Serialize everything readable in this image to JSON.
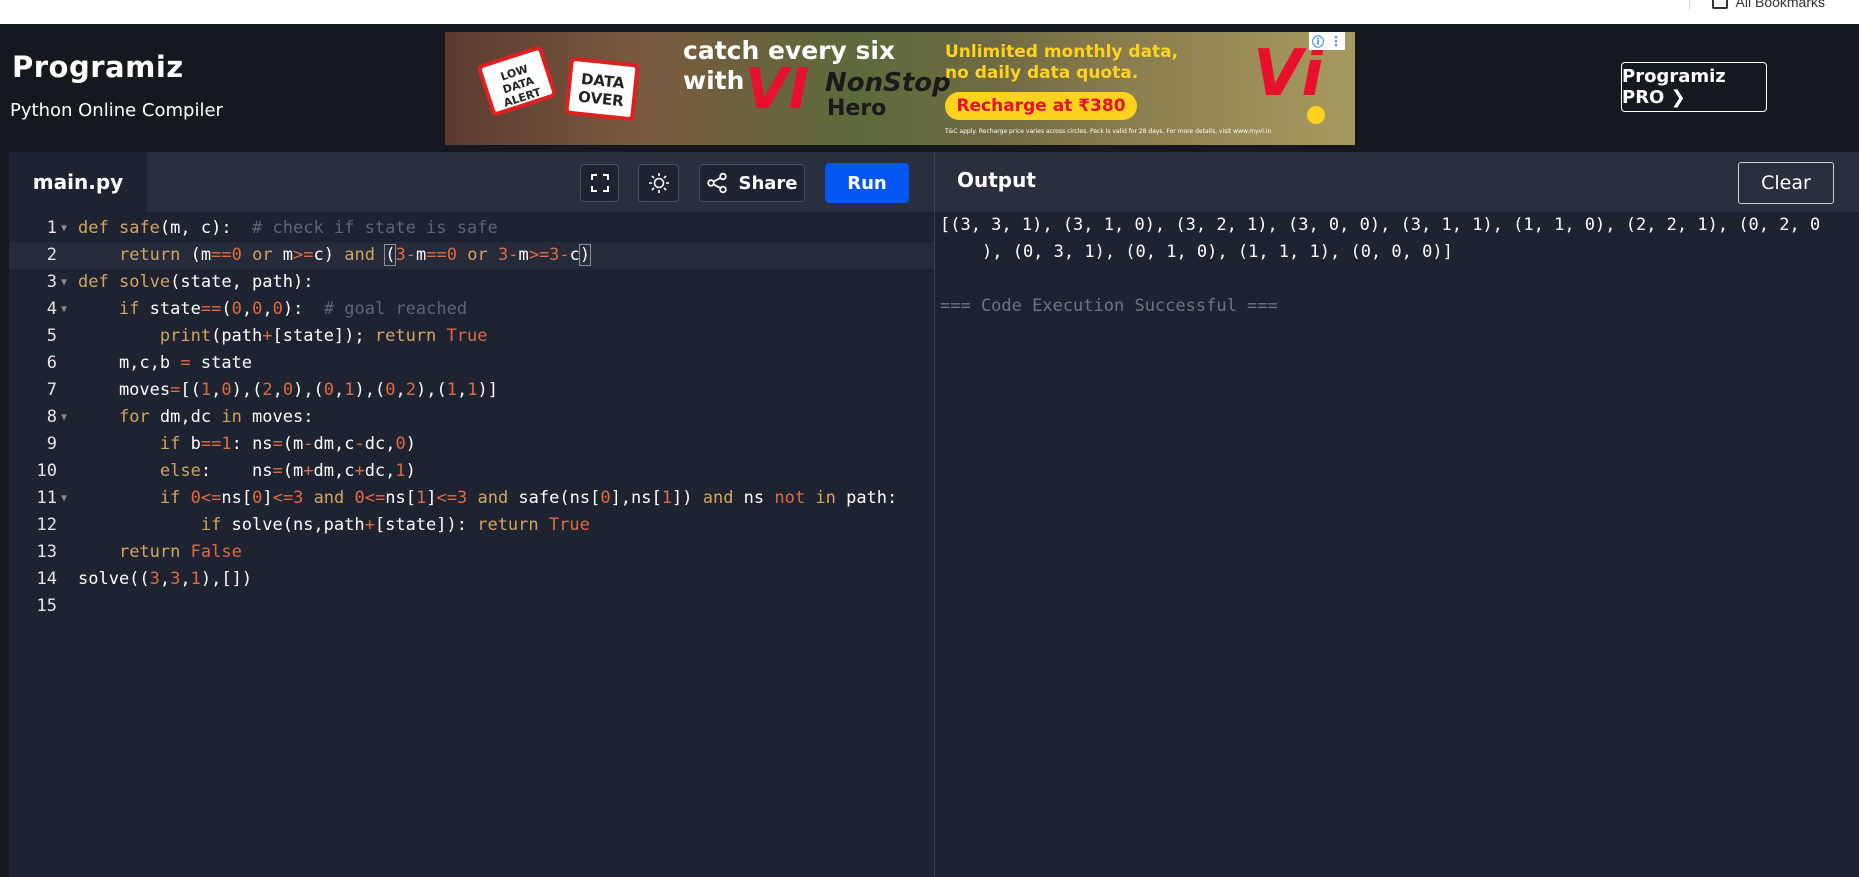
{
  "browser": {
    "bookmarks_label": "All Bookmarks"
  },
  "header": {
    "logo": "Programiz",
    "subtitle": "Python Online Compiler",
    "pro_button": "Programiz PRO ❯"
  },
  "ad": {
    "sign1": "LOW DATA ALERT",
    "sign2": "DATA OVER",
    "catch": "catch every six",
    "with": "with",
    "vi": "VI",
    "nonstop": "NonStop",
    "hero": "Hero",
    "unlimited": "Unlimited monthly data,",
    "no_daily": "no daily data quota.",
    "recharge": "Recharge at ₹380",
    "tc": "T&C apply. Recharge price varies across circles. Pack is valid for 28 days. For more details, visit www.myvi.in",
    "brand": "Vi"
  },
  "editor": {
    "file_tab": "main.py",
    "share_label": "Share",
    "run_label": "Run",
    "line_numbers": [
      "1",
      "2",
      "3",
      "4",
      "5",
      "6",
      "7",
      "8",
      "9",
      "10",
      "11",
      "12",
      "13",
      "14",
      "15"
    ]
  },
  "output": {
    "title": "Output",
    "clear_label": "Clear",
    "line1": "[(3, 3, 1), (3, 1, 0), (3, 2, 1), (3, 0, 0), (3, 1, 1), (1, 1, 0), (2, 2, 1), (0, 2, 0",
    "line2": "), (0, 3, 1), (0, 1, 0), (1, 1, 1), (0, 0, 0)]",
    "success": "=== Code Execution Successful ==="
  },
  "colors": {
    "run_button": "#0556f3",
    "keyword": "#d4a45c",
    "number": "#e06a3c",
    "comment": "#5d6476",
    "editor_bg": "#1e2332"
  },
  "icons": [
    "fullscreen-icon",
    "theme-sun-icon",
    "share-icon",
    "info-icon",
    "bookmark-folder-icon"
  ]
}
